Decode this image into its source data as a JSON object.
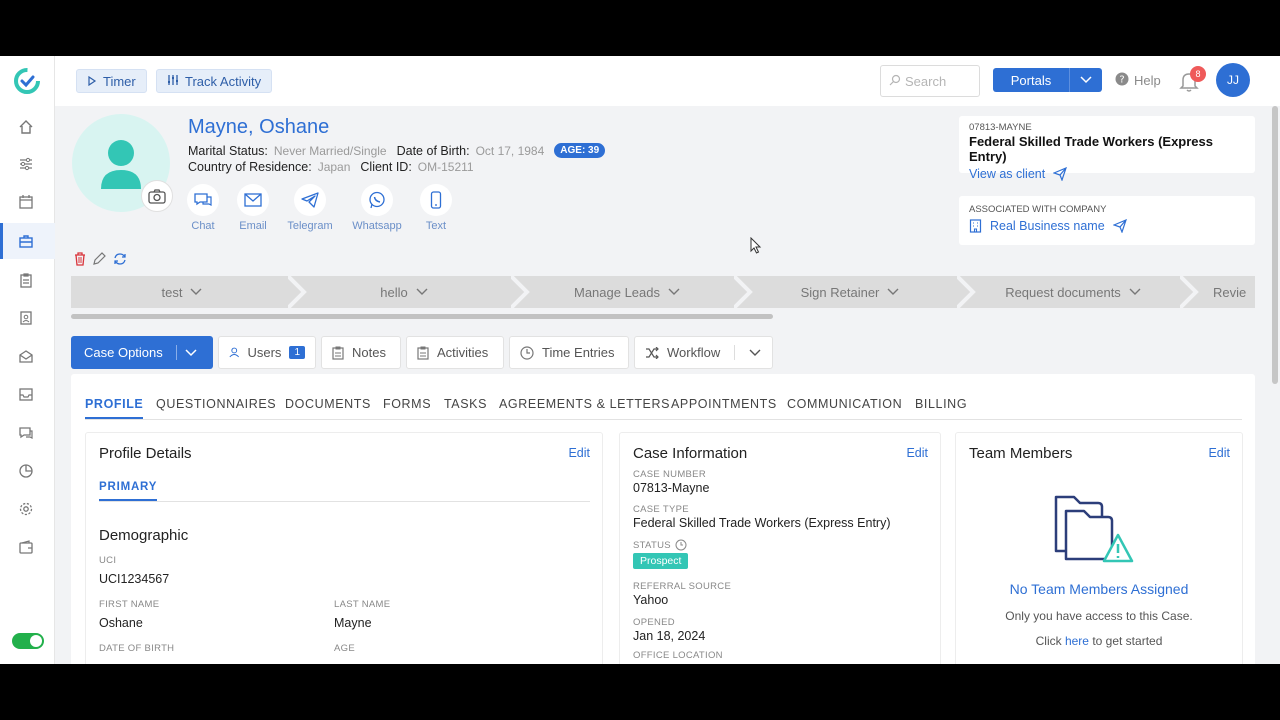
{
  "topbar": {
    "timer_label": "Timer",
    "track_activity_label": "Track Activity",
    "search_placeholder": "Search",
    "portals_label": "Portals",
    "help_label": "Help",
    "notifications_count": "8",
    "user_initials": "JJ"
  },
  "client": {
    "name": "Mayne, Oshane",
    "marital_status_label": "Marital Status:",
    "marital_status": "Never Married/Single",
    "dob_label": "Date of Birth:",
    "dob": "Oct 17, 1984",
    "age_badge": "AGE: 39",
    "country_label": "Country of Residence:",
    "country": "Japan",
    "client_id_label": "Client ID:",
    "client_id": "OM-15211"
  },
  "contacts": [
    "Chat",
    "Email",
    "Telegram",
    "Whatsapp",
    "Text"
  ],
  "case_card": {
    "case_code": "07813-MAYNE",
    "case_type": "Federal Skilled Trade Workers (Express Entry)",
    "view_link": "View as client"
  },
  "company_card": {
    "label": "ASSOCIATED WITH COMPANY",
    "company": "Real Business name"
  },
  "stages": [
    "test",
    "hello",
    "Manage Leads",
    "Sign Retainer",
    "Request documents",
    "Revie"
  ],
  "toolbar": {
    "case_options": "Case Options",
    "users": "Users",
    "users_count": "1",
    "notes": "Notes",
    "activities": "Activities",
    "time_entries": "Time Entries",
    "workflow": "Workflow"
  },
  "tabs": [
    "PROFILE",
    "QUESTIONNAIRES",
    "DOCUMENTS",
    "FORMS",
    "TASKS",
    "AGREEMENTS & LETTERS",
    "APPOINTMENTS",
    "COMMUNICATION",
    "BILLING"
  ],
  "profile": {
    "title": "Profile Details",
    "edit": "Edit",
    "subtab": "PRIMARY",
    "section": "Demographic",
    "uci_label": "UCI",
    "uci": "UCI1234567",
    "first_name_label": "FIRST NAME",
    "first_name": "Oshane",
    "last_name_label": "LAST NAME",
    "last_name": "Mayne",
    "dob_label": "DATE OF BIRTH",
    "age_label": "AGE"
  },
  "case_info": {
    "title": "Case Information",
    "edit": "Edit",
    "case_number_label": "CASE NUMBER",
    "case_number": "07813-Mayne",
    "case_type_label": "CASE TYPE",
    "case_type": "Federal Skilled Trade Workers (Express Entry)",
    "status_label": "STATUS",
    "status": "Prospect",
    "referral_label": "REFERRAL SOURCE",
    "referral": "Yahoo",
    "opened_label": "OPENED",
    "opened": "Jan 18, 2024",
    "office_label": "OFFICE LOCATION"
  },
  "team": {
    "title": "Team Members",
    "edit": "Edit",
    "empty_title": "No Team Members Assigned",
    "empty_desc": "Only you have access to this Case.",
    "cta_prefix": "Click",
    "cta_link": "here",
    "cta_suffix": "to get started"
  },
  "colors": {
    "accent": "#2e6fd4",
    "prospect": "#33c6b5",
    "avatar_bg": "#d8f4f1",
    "avatar_fg": "#33c6b5",
    "toggle_on": "#22b04b",
    "notification": "#ef5a5a"
  }
}
